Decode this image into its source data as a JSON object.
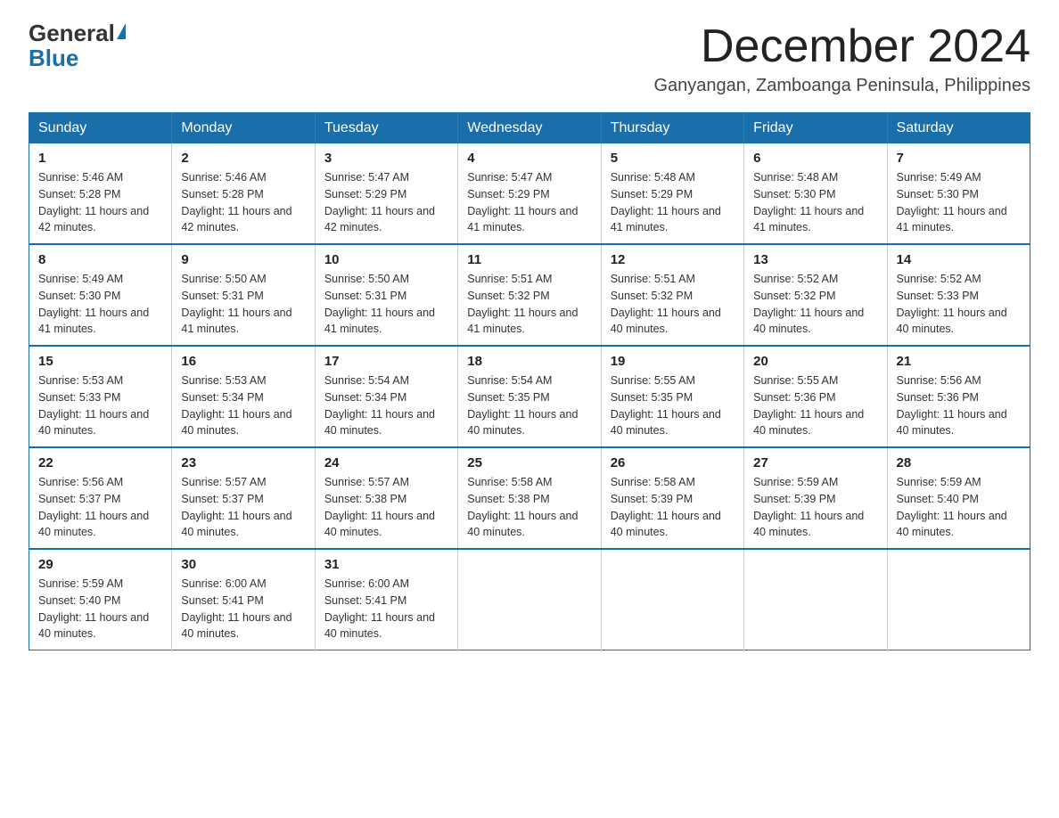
{
  "logo": {
    "general": "General",
    "blue": "Blue"
  },
  "header": {
    "month": "December 2024",
    "location": "Ganyangan, Zamboanga Peninsula, Philippines"
  },
  "weekdays": [
    "Sunday",
    "Monday",
    "Tuesday",
    "Wednesday",
    "Thursday",
    "Friday",
    "Saturday"
  ],
  "weeks": [
    [
      {
        "day": "1",
        "sunrise": "5:46 AM",
        "sunset": "5:28 PM",
        "daylight": "11 hours and 42 minutes."
      },
      {
        "day": "2",
        "sunrise": "5:46 AM",
        "sunset": "5:28 PM",
        "daylight": "11 hours and 42 minutes."
      },
      {
        "day": "3",
        "sunrise": "5:47 AM",
        "sunset": "5:29 PM",
        "daylight": "11 hours and 42 minutes."
      },
      {
        "day": "4",
        "sunrise": "5:47 AM",
        "sunset": "5:29 PM",
        "daylight": "11 hours and 41 minutes."
      },
      {
        "day": "5",
        "sunrise": "5:48 AM",
        "sunset": "5:29 PM",
        "daylight": "11 hours and 41 minutes."
      },
      {
        "day": "6",
        "sunrise": "5:48 AM",
        "sunset": "5:30 PM",
        "daylight": "11 hours and 41 minutes."
      },
      {
        "day": "7",
        "sunrise": "5:49 AM",
        "sunset": "5:30 PM",
        "daylight": "11 hours and 41 minutes."
      }
    ],
    [
      {
        "day": "8",
        "sunrise": "5:49 AM",
        "sunset": "5:30 PM",
        "daylight": "11 hours and 41 minutes."
      },
      {
        "day": "9",
        "sunrise": "5:50 AM",
        "sunset": "5:31 PM",
        "daylight": "11 hours and 41 minutes."
      },
      {
        "day": "10",
        "sunrise": "5:50 AM",
        "sunset": "5:31 PM",
        "daylight": "11 hours and 41 minutes."
      },
      {
        "day": "11",
        "sunrise": "5:51 AM",
        "sunset": "5:32 PM",
        "daylight": "11 hours and 41 minutes."
      },
      {
        "day": "12",
        "sunrise": "5:51 AM",
        "sunset": "5:32 PM",
        "daylight": "11 hours and 40 minutes."
      },
      {
        "day": "13",
        "sunrise": "5:52 AM",
        "sunset": "5:32 PM",
        "daylight": "11 hours and 40 minutes."
      },
      {
        "day": "14",
        "sunrise": "5:52 AM",
        "sunset": "5:33 PM",
        "daylight": "11 hours and 40 minutes."
      }
    ],
    [
      {
        "day": "15",
        "sunrise": "5:53 AM",
        "sunset": "5:33 PM",
        "daylight": "11 hours and 40 minutes."
      },
      {
        "day": "16",
        "sunrise": "5:53 AM",
        "sunset": "5:34 PM",
        "daylight": "11 hours and 40 minutes."
      },
      {
        "day": "17",
        "sunrise": "5:54 AM",
        "sunset": "5:34 PM",
        "daylight": "11 hours and 40 minutes."
      },
      {
        "day": "18",
        "sunrise": "5:54 AM",
        "sunset": "5:35 PM",
        "daylight": "11 hours and 40 minutes."
      },
      {
        "day": "19",
        "sunrise": "5:55 AM",
        "sunset": "5:35 PM",
        "daylight": "11 hours and 40 minutes."
      },
      {
        "day": "20",
        "sunrise": "5:55 AM",
        "sunset": "5:36 PM",
        "daylight": "11 hours and 40 minutes."
      },
      {
        "day": "21",
        "sunrise": "5:56 AM",
        "sunset": "5:36 PM",
        "daylight": "11 hours and 40 minutes."
      }
    ],
    [
      {
        "day": "22",
        "sunrise": "5:56 AM",
        "sunset": "5:37 PM",
        "daylight": "11 hours and 40 minutes."
      },
      {
        "day": "23",
        "sunrise": "5:57 AM",
        "sunset": "5:37 PM",
        "daylight": "11 hours and 40 minutes."
      },
      {
        "day": "24",
        "sunrise": "5:57 AM",
        "sunset": "5:38 PM",
        "daylight": "11 hours and 40 minutes."
      },
      {
        "day": "25",
        "sunrise": "5:58 AM",
        "sunset": "5:38 PM",
        "daylight": "11 hours and 40 minutes."
      },
      {
        "day": "26",
        "sunrise": "5:58 AM",
        "sunset": "5:39 PM",
        "daylight": "11 hours and 40 minutes."
      },
      {
        "day": "27",
        "sunrise": "5:59 AM",
        "sunset": "5:39 PM",
        "daylight": "11 hours and 40 minutes."
      },
      {
        "day": "28",
        "sunrise": "5:59 AM",
        "sunset": "5:40 PM",
        "daylight": "11 hours and 40 minutes."
      }
    ],
    [
      {
        "day": "29",
        "sunrise": "5:59 AM",
        "sunset": "5:40 PM",
        "daylight": "11 hours and 40 minutes."
      },
      {
        "day": "30",
        "sunrise": "6:00 AM",
        "sunset": "5:41 PM",
        "daylight": "11 hours and 40 minutes."
      },
      {
        "day": "31",
        "sunrise": "6:00 AM",
        "sunset": "5:41 PM",
        "daylight": "11 hours and 40 minutes."
      },
      null,
      null,
      null,
      null
    ]
  ]
}
